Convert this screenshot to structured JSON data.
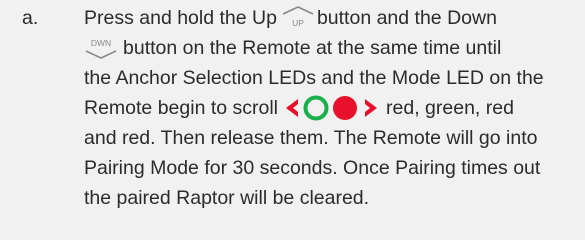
{
  "step": {
    "marker": "a.",
    "line1_a": "Press and hold the Up",
    "line1_b": "button and the Down",
    "line2": "button on the Remote at the same time until",
    "line3": "the Anchor Selection LEDs and the Mode LED on the",
    "line4_a": "Remote begin to scroll",
    "line4_b": "red, green, red",
    "line5": "and red. Then release them. The Remote will go into",
    "line6": "Pairing Mode for 30 seconds. Once Pairing times out",
    "line7": "the paired Raptor will be cleared."
  },
  "icons": {
    "up_button": {
      "name": "up-button-icon",
      "label": "UP"
    },
    "down_button": {
      "name": "down-button-icon",
      "label": "DWN"
    },
    "led_sequence": [
      "left-arrow-red",
      "circle-green",
      "circle-red",
      "right-arrow-red"
    ]
  },
  "colors": {
    "text": "#2b2b2b",
    "background": "#f1f1f2",
    "icon_gray": "#8a8a8a",
    "led_red": "#e8102a",
    "led_green": "#18b04a"
  }
}
